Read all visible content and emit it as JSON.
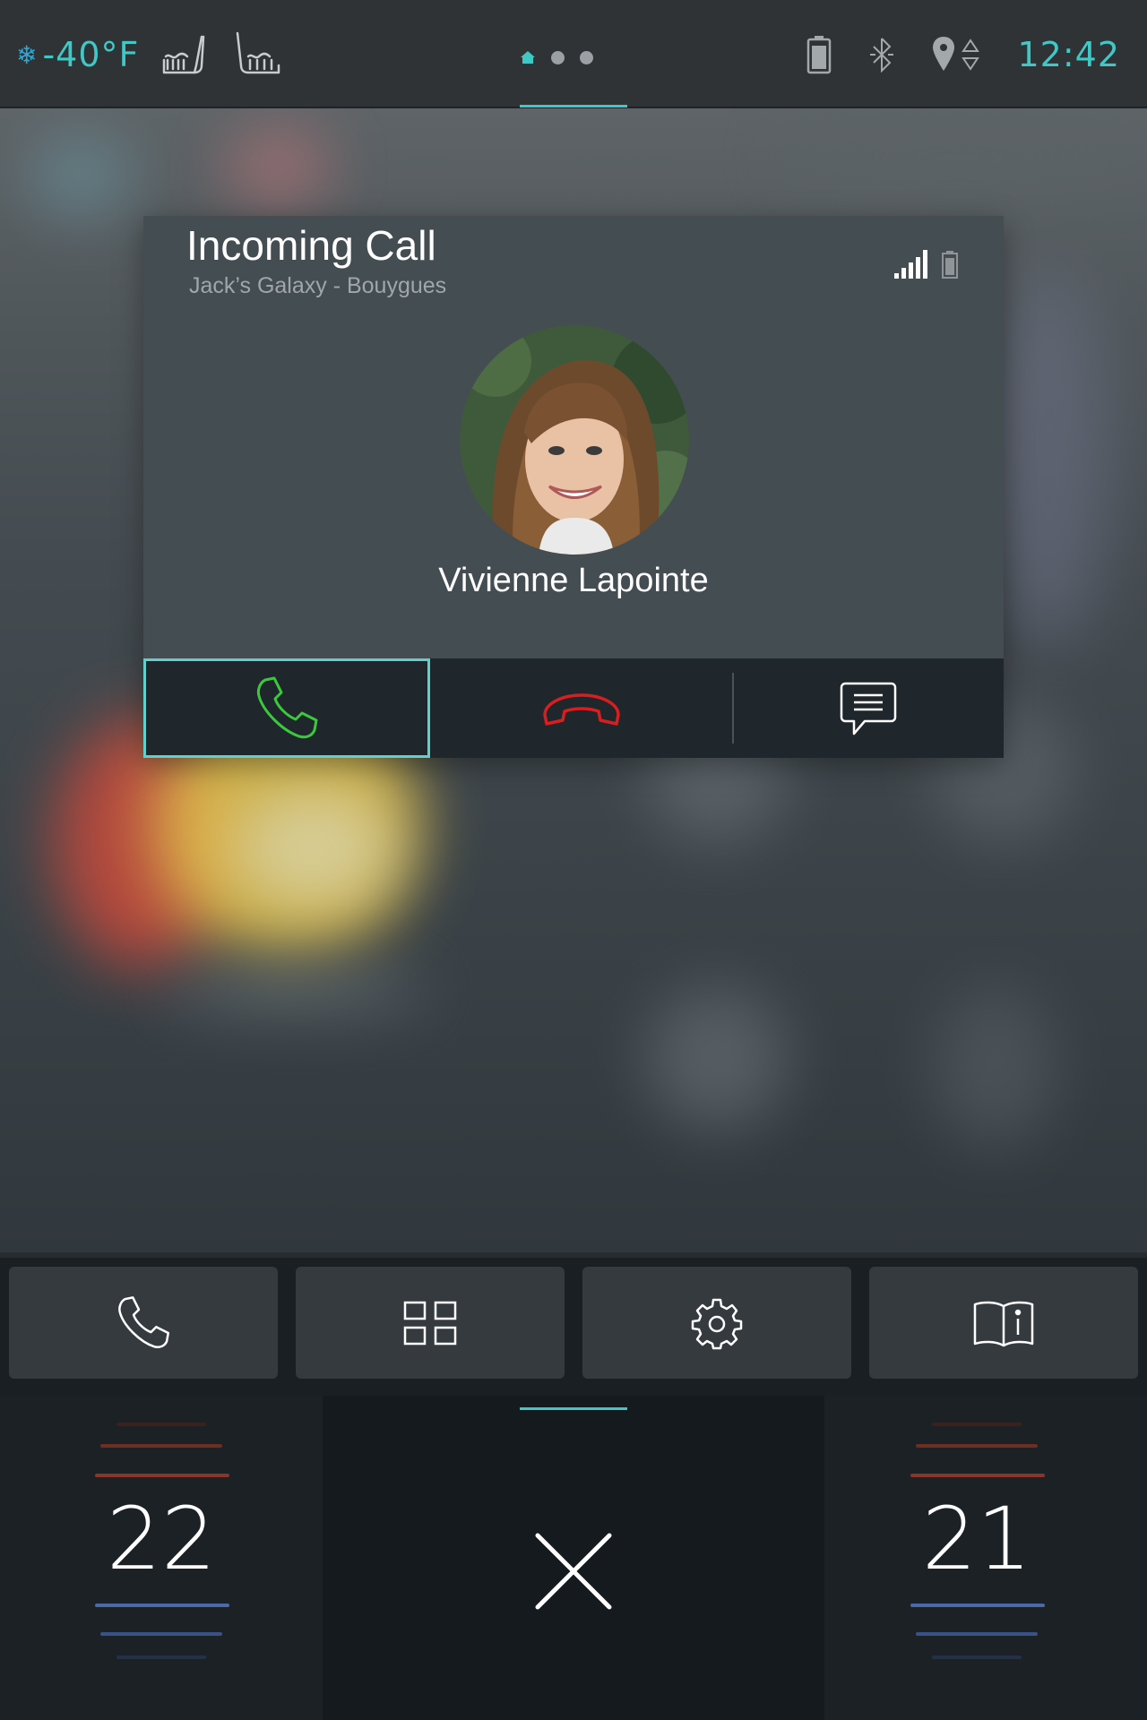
{
  "status_bar": {
    "outside_temp": "-40°F",
    "icons": [
      "snowflake-icon",
      "seat-heat-icon",
      "seat-heat-rear-icon",
      "battery-icon",
      "bluetooth-icon",
      "location-icon",
      "clock"
    ],
    "pager": {
      "pages": 3,
      "active": 0
    },
    "time": "12:42"
  },
  "call": {
    "title": "Incoming Call",
    "subtitle": "Jack’s Galaxy - Bouygues",
    "caller_name": "Vivienne Lapointe",
    "actions": [
      "accept",
      "decline",
      "message"
    ]
  },
  "dock": {
    "items": [
      "phone-icon",
      "apps-grid-icon",
      "settings-icon",
      "manual-icon"
    ]
  },
  "climate": {
    "left_temp": "22",
    "right_temp": "21"
  },
  "colors": {
    "accent": "#3fc8c6",
    "accept": "#3cc83c",
    "decline": "#d81e1e",
    "heat": "#8a3527",
    "cool": "#4a6aa8"
  }
}
